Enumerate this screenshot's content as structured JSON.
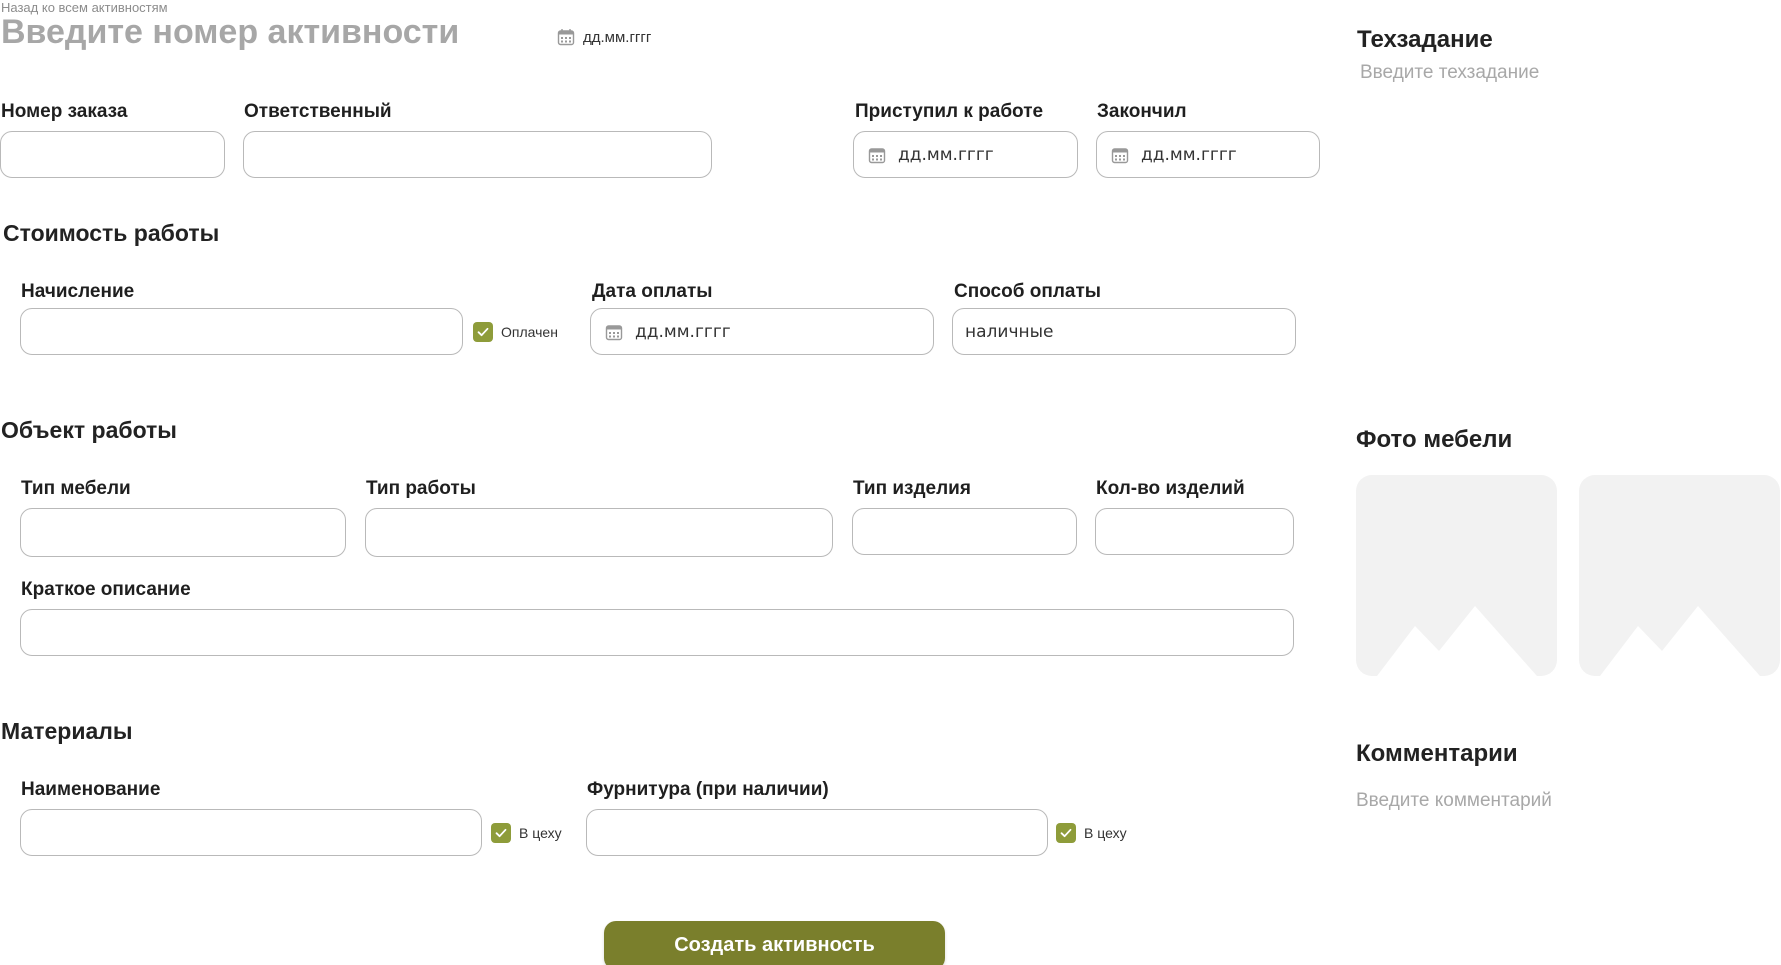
{
  "header": {
    "back_link": "Назад ко всем активностям",
    "title_placeholder": "Введите номер активности",
    "date_placeholder": "дд.мм.гггг"
  },
  "order": {
    "order_number_label": "Номер заказа",
    "order_number_value": "",
    "responsible_label": "Ответственный",
    "responsible_value": "",
    "started_label": "Приступил к работе",
    "started_placeholder": "дд.мм.гггг",
    "finished_label": "Закончил",
    "finished_placeholder": "дд.мм.гггг"
  },
  "cost": {
    "section_title": "Стоимость работы",
    "accrual_label": "Начисление",
    "accrual_value": "",
    "paid_label": "Оплачен",
    "paid_checked": true,
    "payment_date_label": "Дата оплаты",
    "payment_date_placeholder": "дд.мм.гггг",
    "payment_method_label": "Способ оплаты",
    "payment_method_value": "наличные"
  },
  "work_object": {
    "section_title": "Объект работы",
    "furniture_type_label": "Тип мебели",
    "work_type_label": "Тип работы",
    "product_type_label": "Тип изделия",
    "product_count_label": "Кол-во изделий",
    "description_label": "Краткое описание"
  },
  "materials": {
    "section_title": "Материалы",
    "name_label": "Наименование",
    "name_in_shop_label": "В цеху",
    "name_in_shop_checked": true,
    "hardware_label": "Фурнитура (при наличии)",
    "hardware_in_shop_label": "В цеху",
    "hardware_in_shop_checked": true
  },
  "sidebar": {
    "spec_title": "Техзадание",
    "spec_placeholder": "Введите техзадание",
    "photos_title": "Фото мебели",
    "photos": [
      {
        "icon": "image-placeholder-icon"
      },
      {
        "icon": "image-placeholder-icon"
      }
    ],
    "comments_title": "Комментарии",
    "comments_placeholder": "Введите комментарий"
  },
  "actions": {
    "submit_label": "Создать активность"
  },
  "colors": {
    "accent": "#7a7f2c",
    "checkbox": "#8e9c3a",
    "placeholder_gray": "#a8a8a8",
    "photo_bg": "#f2f2f2",
    "field_border": "#b9b9b9"
  },
  "icons": {
    "calendar": "calendar-icon",
    "check": "checkmark-icon",
    "photo": "image-placeholder-icon"
  }
}
